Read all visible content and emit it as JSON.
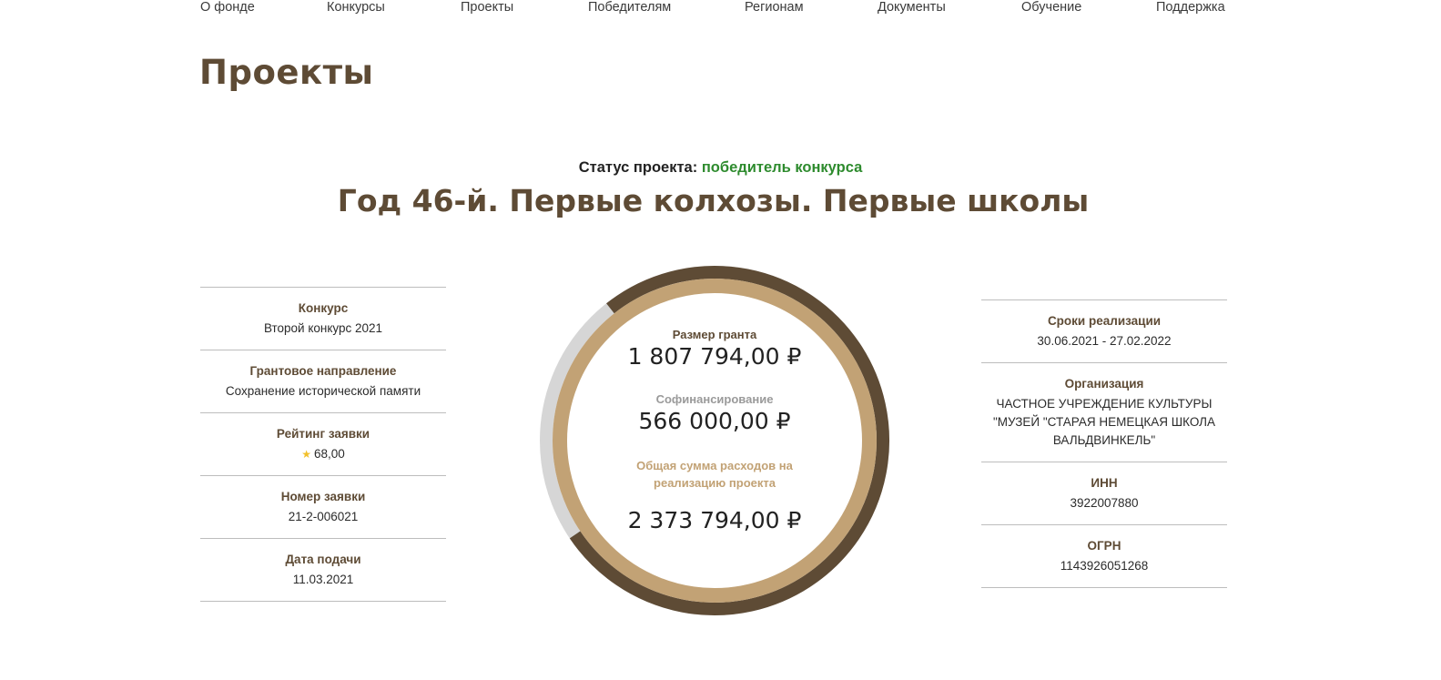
{
  "nav": {
    "items": [
      "О фонде",
      "Конкурсы",
      "Проекты",
      "Победителям",
      "Регионам",
      "Документы",
      "Обучение",
      "Поддержка"
    ]
  },
  "page": {
    "title": "Проекты"
  },
  "status": {
    "label": "Статус проекта:",
    "value": "победитель конкурса",
    "value_color": "#2e8b2e"
  },
  "project": {
    "title": "Год 46-й. Первые колхозы. Первые школы"
  },
  "left_info": [
    {
      "label": "Конкурс",
      "value": "Второй конкурс 2021"
    },
    {
      "label": "Грантовое направление",
      "value": "Сохранение исторической памяти"
    },
    {
      "label": "Рейтинг заявки",
      "value": "68,00",
      "icon": "star-icon"
    },
    {
      "label": "Номер заявки",
      "value": "21-2-006021"
    },
    {
      "label": "Дата подачи",
      "value": "11.03.2021"
    }
  ],
  "right_info": [
    {
      "label": "Сроки реализации",
      "value": "30.06.2021 - 27.02.2022"
    },
    {
      "label": "Организация",
      "value": "ЧАСТНОЕ УЧРЕЖДЕНИЕ КУЛЬТУРЫ \"МУЗЕЙ \"СТАРАЯ НЕМЕЦКАЯ ШКОЛА ВАЛЬДВИНКЕЛЬ\""
    },
    {
      "label": "ИНН",
      "value": "3922007880"
    },
    {
      "label": "ОГРН",
      "value": "1143926051268"
    }
  ],
  "finance": {
    "grant_label": "Размер гранта",
    "grant_value": "1 807 794,00 ₽",
    "cofin_label": "Софинансирование",
    "cofin_value": "566 000,00 ₽",
    "total_label": "Общая сумма расходов на реализацию проекта",
    "total_value": "2 373 794,00 ₽",
    "grant_share": 0.7616,
    "colors": {
      "grant": "#5e4b35",
      "cofin": "#d6d6d6",
      "inner": "#c2a275",
      "grant_label": "#5e4b35",
      "cofin_label": "#9a9a9a",
      "total_label": "#c2a275"
    }
  }
}
